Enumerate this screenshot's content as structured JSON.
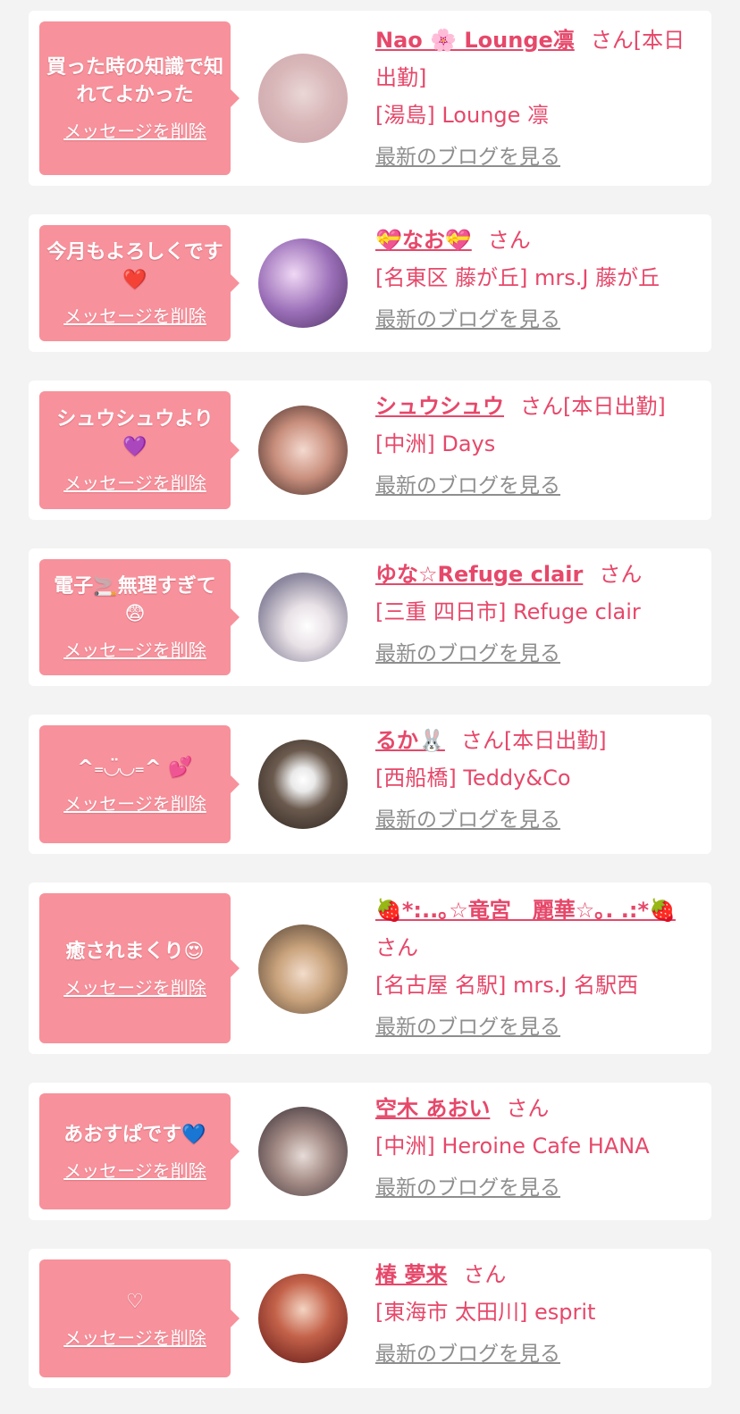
{
  "items": [
    {
      "message": "買った時の知識で知れてよかった",
      "delete_label": "メッセージを削除",
      "name": "Nao 🌸 Lounge凛",
      "honorific": "さん",
      "status": "[本日出勤]",
      "shop": "[湯島] Lounge 凛",
      "blog_label": "最新のブログを見る"
    },
    {
      "message": "今月もよろしくです❤️",
      "delete_label": "メッセージを削除",
      "name": "💝なお💝",
      "honorific": "さん",
      "status": "",
      "shop": "[名東区 藤が丘] mrs.J 藤が丘",
      "blog_label": "最新のブログを見る"
    },
    {
      "message": "シュウシュウより💜",
      "delete_label": "メッセージを削除",
      "name": "シュウシュウ",
      "honorific": "さん",
      "status": "[本日出勤]",
      "shop": "[中洲] Days",
      "blog_label": "最新のブログを見る"
    },
    {
      "message": "電子🚬無理すぎて😨",
      "delete_label": "メッセージを削除",
      "name": "ゆな☆Refuge clair",
      "honorific": "さん",
      "status": "",
      "shop": "[三重 四日市] Refuge clair",
      "blog_label": "最新のブログを見る"
    },
    {
      "message": "^₌◡̈◡₌^ 💕",
      "delete_label": "メッセージを削除",
      "name": "るか🐰",
      "honorific": "さん",
      "status": "[本日出勤]",
      "shop": "[西船橋] Teddy&Co",
      "blog_label": "最新のブログを見る"
    },
    {
      "message": "癒されまくり😍",
      "delete_label": "メッセージを削除",
      "name": "🍓*:..｡☆竜宮　麗華☆｡. .:*🍓",
      "honorific": "さん",
      "status": "",
      "shop": "[名古屋 名駅] mrs.J 名駅西",
      "blog_label": "最新のブログを見る"
    },
    {
      "message": "あおすぱです💙",
      "delete_label": "メッセージを削除",
      "name": "空木 あおい",
      "honorific": "さん",
      "status": "",
      "shop": "[中洲] Heroine Cafe HANA",
      "blog_label": "最新のブログを見る"
    },
    {
      "message": "♡",
      "delete_label": "メッセージを削除",
      "name": "椿 夢来",
      "honorific": "さん",
      "status": "",
      "shop": "[東海市 太田川] esprit",
      "blog_label": "最新のブログを見る"
    }
  ],
  "colors": {
    "accent": "#e6486a",
    "bubble": "#f7919b",
    "muted": "#8e8e8e",
    "background": "#f3f3f3"
  },
  "icons": [
    "avatar-photo"
  ]
}
